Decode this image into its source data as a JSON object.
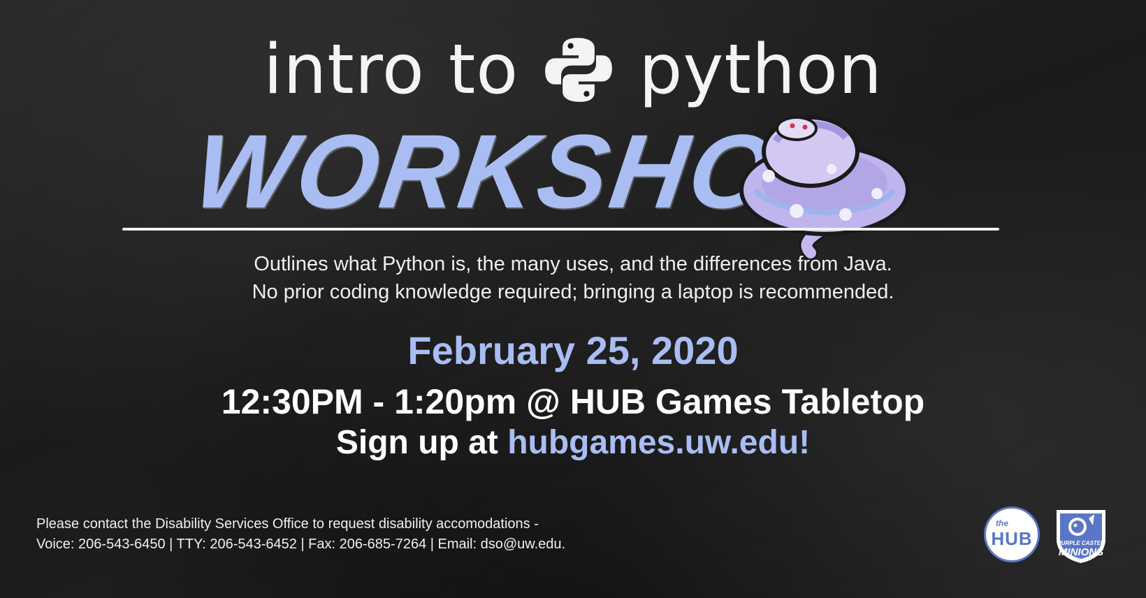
{
  "title": {
    "intro": "intro",
    "to": "to",
    "python": "python",
    "workshop": "WORKSHOP"
  },
  "description": {
    "line1": "Outlines what Python is, the many uses, and the differences from Java.",
    "line2": "No prior coding knowledge required; bringing a laptop is recommended."
  },
  "event": {
    "date": "February 25, 2020",
    "time_location": "12:30PM - 1:20pm @ HUB Games Tabletop",
    "signup_prefix": "Sign up at ",
    "signup_link": "hubgames.uw.edu!"
  },
  "accessibility": {
    "line1": "Please contact the Disability Services Office to request disability accomodations -",
    "line2": "Voice: 206-543-6450 | TTY: 206-543-6452 | Fax: 206-685-7264 | Email: dso@uw.edu."
  },
  "logos": {
    "hub_small": "the",
    "hub_main": "HUB",
    "minions_line1": "PURPLE CASTER",
    "minions_line2": "MINIONS"
  },
  "icons": [
    "python-logo-icon",
    "snake-illustration-icon",
    "hub-logo-icon",
    "minions-logo-icon"
  ],
  "colors": {
    "accent": "#a9bdf2",
    "background": "#1c1c1c",
    "text": "#ffffff",
    "logo_blue": "#5a76c8"
  }
}
